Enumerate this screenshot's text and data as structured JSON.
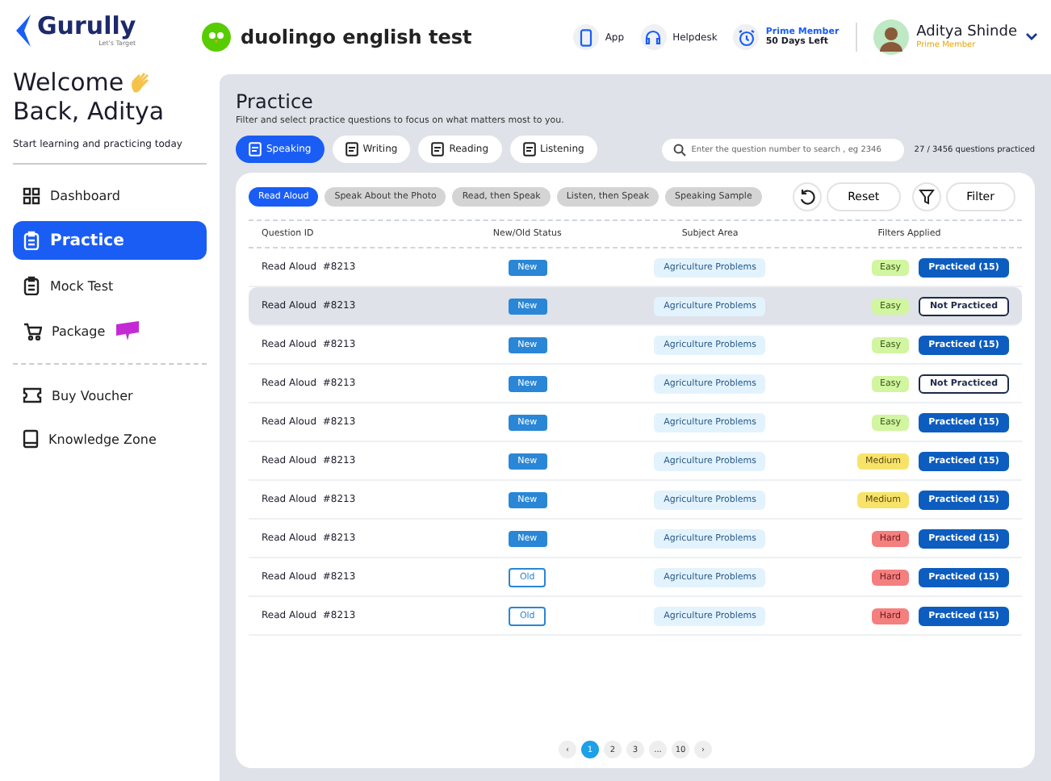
{
  "brand": {
    "logo": "Gurully",
    "tagline": "Let's Target"
  },
  "test_logo": "duolingo english test",
  "header": {
    "links": [
      {
        "label": "App",
        "kind": "phone"
      },
      {
        "label": "Helpdesk",
        "kind": "headset"
      }
    ],
    "membership": {
      "title": "Prime Member",
      "subtitle": "50 Days Left"
    },
    "user": {
      "name": "Aditya Shinde",
      "role": "Prime Member"
    }
  },
  "welcome": {
    "title": "Welcome",
    "name": "Back, Aditya",
    "subtitle": "Start learning and practicing today"
  },
  "sidebar": {
    "items": [
      {
        "label": "Dashboard",
        "kind": "grid",
        "selected": false,
        "new": false
      },
      {
        "label": "Practice",
        "kind": "clipboard",
        "selected": true,
        "new": false
      },
      {
        "label": "Mock Test",
        "kind": "clipboard",
        "selected": false,
        "new": false
      },
      {
        "label": "Package",
        "kind": "cart",
        "selected": false,
        "new": true
      }
    ],
    "secondary": [
      {
        "label": "Buy Voucher",
        "kind": "ticket"
      },
      {
        "label": "Knowledge Zone",
        "kind": "book"
      }
    ]
  },
  "practice": {
    "title": "Practice",
    "subtitle": "Filter and select practice questions to focus on what matters most to you.",
    "tabs": [
      {
        "label": "Speaking",
        "selected": true
      },
      {
        "label": "Writing",
        "selected": false
      },
      {
        "label": "Reading",
        "selected": false
      },
      {
        "label": "Listening",
        "selected": false
      }
    ],
    "search": {
      "placeholder": "Enter the question number to search , eg 2346"
    },
    "progress": "27 / 3456 questions practiced",
    "subtabs": [
      {
        "label": "Read Aloud",
        "selected": true
      },
      {
        "label": "Speak About the Photo",
        "selected": false
      },
      {
        "label": "Read, then Speak",
        "selected": false
      },
      {
        "label": "Listen, then Speak",
        "selected": false
      },
      {
        "label": "Speaking Sample",
        "selected": false
      }
    ],
    "reset": "Reset",
    "filter": "Filter"
  },
  "table": {
    "columns": [
      "Question ID",
      "New/Old Status",
      "Subject Area",
      "Filters Applied"
    ],
    "rows": [
      {
        "id": "Read Aloud  #8213",
        "status": {
          "label": "New",
          "kind": "new"
        },
        "subject": "Agriculture Problems",
        "difficulty": {
          "label": "Easy",
          "kind": "easy"
        },
        "practice": "Practiced (15)",
        "practiced": true,
        "selected": false
      },
      {
        "id": "Read Aloud  #8213",
        "status": {
          "label": "New",
          "kind": "new"
        },
        "subject": "Agriculture Problems",
        "difficulty": {
          "label": "Easy",
          "kind": "easy"
        },
        "practice": "Not Practiced",
        "practiced": false,
        "selected": true
      },
      {
        "id": "Read Aloud  #8213",
        "status": {
          "label": "New",
          "kind": "new"
        },
        "subject": "Agriculture Problems",
        "difficulty": {
          "label": "Easy",
          "kind": "easy"
        },
        "practice": "Practiced (15)",
        "practiced": true,
        "selected": false
      },
      {
        "id": "Read Aloud  #8213",
        "status": {
          "label": "New",
          "kind": "new"
        },
        "subject": "Agriculture Problems",
        "difficulty": {
          "label": "Easy",
          "kind": "easy"
        },
        "practice": "Not Practiced",
        "practiced": false,
        "selected": false
      },
      {
        "id": "Read Aloud  #8213",
        "status": {
          "label": "New",
          "kind": "new"
        },
        "subject": "Agriculture Problems",
        "difficulty": {
          "label": "Easy",
          "kind": "easy"
        },
        "practice": "Practiced (15)",
        "practiced": true,
        "selected": false
      },
      {
        "id": "Read Aloud  #8213",
        "status": {
          "label": "New",
          "kind": "new"
        },
        "subject": "Agriculture Problems",
        "difficulty": {
          "label": "Medium",
          "kind": "medium"
        },
        "practice": "Practiced (15)",
        "practiced": true,
        "selected": false
      },
      {
        "id": "Read Aloud  #8213",
        "status": {
          "label": "New",
          "kind": "new"
        },
        "subject": "Agriculture Problems",
        "difficulty": {
          "label": "Medium",
          "kind": "medium"
        },
        "practice": "Practiced (15)",
        "practiced": true,
        "selected": false
      },
      {
        "id": "Read Aloud  #8213",
        "status": {
          "label": "New",
          "kind": "new"
        },
        "subject": "Agriculture Problems",
        "difficulty": {
          "label": "Hard",
          "kind": "hard"
        },
        "practice": "Practiced (15)",
        "practiced": true,
        "selected": false
      },
      {
        "id": "Read Aloud  #8213",
        "status": {
          "label": "Old",
          "kind": "old"
        },
        "subject": "Agriculture Problems",
        "difficulty": {
          "label": "Hard",
          "kind": "hard"
        },
        "practice": "Practiced (15)",
        "practiced": true,
        "selected": false
      },
      {
        "id": "Read Aloud  #8213",
        "status": {
          "label": "Old",
          "kind": "old"
        },
        "subject": "Agriculture Problems",
        "difficulty": {
          "label": "Hard",
          "kind": "hard"
        },
        "practice": "Practiced (15)",
        "practiced": true,
        "selected": false
      }
    ]
  },
  "pagination": {
    "prev": "‹",
    "next": "›",
    "pages": [
      {
        "label": "1",
        "selected": true
      },
      {
        "label": "2",
        "selected": false
      },
      {
        "label": "3",
        "selected": false
      },
      {
        "label": "...",
        "selected": false
      },
      {
        "label": "10",
        "selected": false
      }
    ]
  }
}
